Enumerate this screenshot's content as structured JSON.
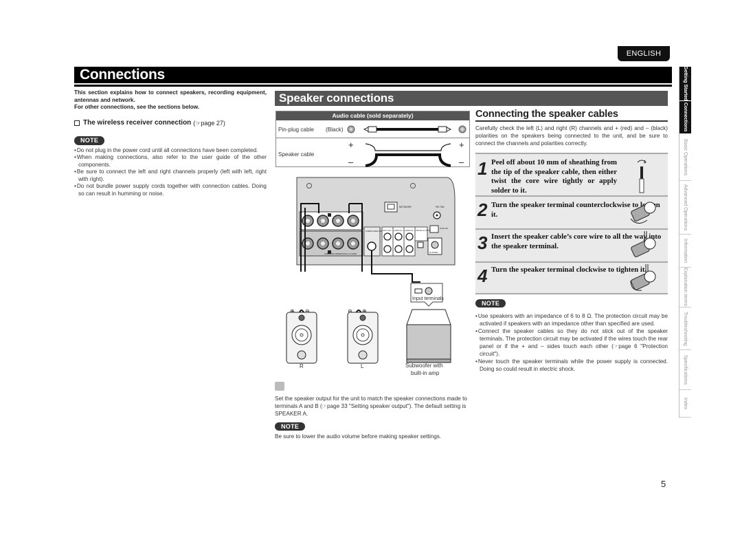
{
  "language_tab": "ENGLISH",
  "page_title": "Connections",
  "intro": {
    "line1": "This section explains how to connect speakers, recording equipment, antennas and network.",
    "line2": "For other connections, see the sections below."
  },
  "wireless_link": {
    "label": "The wireless receiver connection",
    "ref": "page 27"
  },
  "note_label": "NOTE",
  "left_notes": [
    "Do not plug in the power cord until all connections have been completed.",
    "When making connections, also refer to the user guide of the other components.",
    "Be sure to connect the left and right channels properly (left with left, right with right).",
    "Do not bundle power supply cords together with connection cables. Doing so can result in humming or noise."
  ],
  "speaker_section": {
    "title": "Speaker connections",
    "cable_table": {
      "header": "Audio cable (sold separately)",
      "rows": [
        {
          "label": "Pin-plug cable",
          "color": "(Black)"
        },
        {
          "label": "Speaker cable",
          "plus": "+",
          "minus": "–"
        }
      ]
    },
    "diagram": {
      "panel_labels": {
        "network": "NETWORK",
        "fm": "FM 75Ω",
        "subwoofer_pre_out": "SUBWOOFER PRE OUT",
        "aux_out": "AUX OUT",
        "audio_in_1": "AUDIO IN",
        "audio_in_2": "AUDIO IN",
        "digital_in": "DIGITAL IN (OPTICAL)",
        "gnd_am": "GND AM",
        "m_xport": "M-XPORT",
        "impedance": "SPEAKERS IMPEDANCE 6~8 OHMS",
        "a": "A",
        "b": "B"
      },
      "input_terminals": "Input terminals",
      "speaker_r": "R",
      "speaker_l": "L",
      "subwoofer_line1": "Subwoofer with",
      "subwoofer_line2": "built-in amp"
    },
    "tip_text": "Set the speaker output for the unit to match the speaker connections made to terminals A and B (☞page 33 \"Setting speaker output\"). The default setting is SPEAKER A.",
    "note_text": "Be sure to lower the audio volume before making speaker settings."
  },
  "connecting_cables": {
    "title": "Connecting the speaker cables",
    "description": "Carefully check the left (L) and right (R) channels and + (red) and – (black) polarities on the speakers being connected to the unit, and be sure to connect the channels and polarities correctly.",
    "steps": [
      {
        "num": "1",
        "text": "Peel off about 10 mm of sheathing from the tip of the speaker cable, then either twist the core wire tightly or apply solder to it."
      },
      {
        "num": "2",
        "text": "Turn the speaker terminal counterclockwise to loosen it."
      },
      {
        "num": "3",
        "text": "Insert the speaker cable’s core wire to all the way into the speaker terminal."
      },
      {
        "num": "4",
        "text": "Turn the speaker terminal clockwise to tighten it."
      }
    ],
    "notes": [
      "Use speakers with an impedance of 6 to 8 Ω. The protection circuit may be activated if speakers with an impedance other than specified are used.",
      "Connect the speaker cables so they do not stick out of the speaker terminals. The protection circuit may be activated if the wires touch the rear panel or if the + and – sides touch each other (☞page 6 \"Protection circuit\").",
      "Never touch the speaker terminals while the power supply is connected. Doing so could result in electric shock."
    ]
  },
  "side_nav": [
    {
      "label": "Getting Started",
      "active": true
    },
    {
      "label": "Connections",
      "active": true
    },
    {
      "label": "Basic Operations",
      "active": false
    },
    {
      "label": "Advanced Operations",
      "active": false
    },
    {
      "label": "Information",
      "active": false
    },
    {
      "label": "Explanation terms",
      "active": false
    },
    {
      "label": "Troubleshooting",
      "active": false
    },
    {
      "label": "Specifications",
      "active": false
    },
    {
      "label": "Index",
      "active": false
    }
  ],
  "page_number": "5"
}
